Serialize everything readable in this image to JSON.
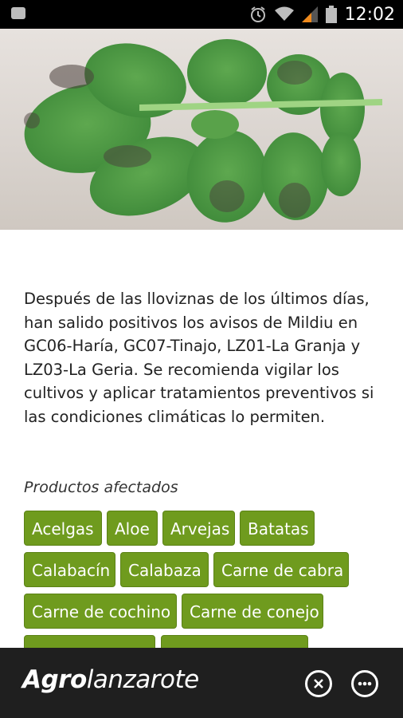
{
  "status_bar": {
    "time": "12:02"
  },
  "article": {
    "body": "Después de las lloviznas de los últimos días, han salido positivos los avisos de Mildiu en GC06-Haría, GC07-Tinajo, LZ01-La Granja y LZ03-La Geria. Se recomienda vigilar los cultivos y aplicar tratamientos preventivos si las condiciones climáticas lo permiten.",
    "products_title": "Productos afectados",
    "products": [
      "Acelgas",
      "Aloe",
      "Arvejas",
      "Batatas",
      "Calabacín",
      "Calabaza",
      "Carne de cabra",
      "Carne de cochino",
      "Carne de conejo"
    ]
  },
  "bottom_bar": {
    "brand_bold": "Agro",
    "brand_rest": "lanzarote"
  },
  "colors": {
    "tag_green": "#6f9b1e",
    "bottom_bar": "#1f1f1f"
  }
}
